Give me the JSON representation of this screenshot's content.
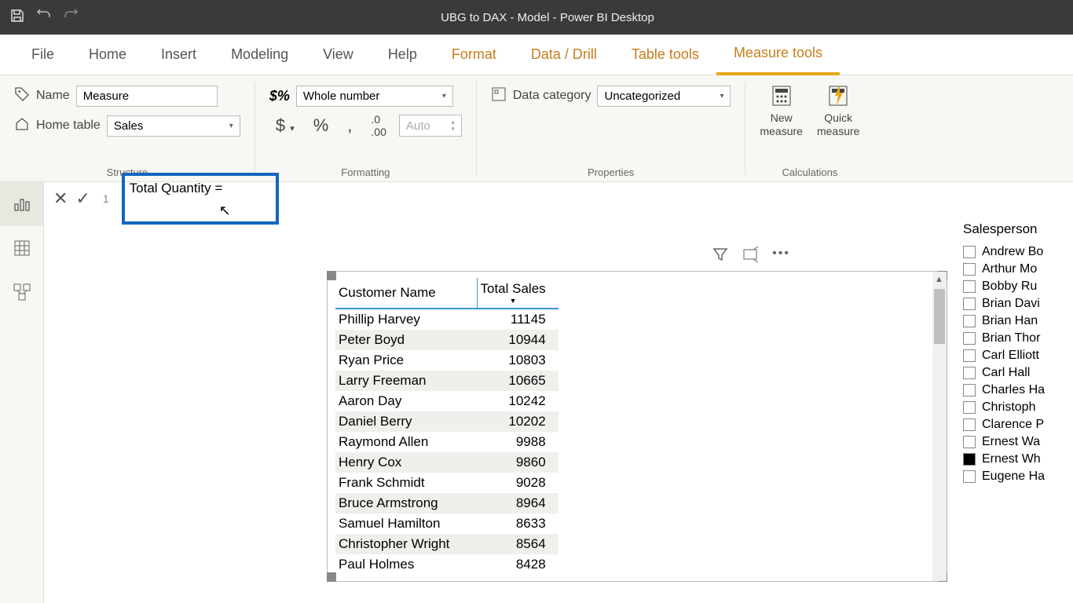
{
  "titlebar": {
    "title": "UBG to DAX - Model - Power BI Desktop"
  },
  "menubar": [
    "File",
    "Home",
    "Insert",
    "Modeling",
    "View",
    "Help",
    "Format",
    "Data / Drill",
    "Table tools",
    "Measure tools"
  ],
  "ribbon": {
    "name_label": "Name",
    "name_value": "Measure",
    "home_table_label": "Home table",
    "home_table_value": "Sales",
    "structure_label": "Structure",
    "format_value": "Whole number",
    "auto_placeholder": "Auto",
    "formatting_label": "Formatting",
    "data_category_label": "Data category",
    "data_category_value": "Uncategorized",
    "properties_label": "Properties",
    "new_measure": "New\nmeasure",
    "quick_measure": "Quick\nmeasure",
    "calculations_label": "Calculations"
  },
  "formula": {
    "line": "1",
    "text": "Total Quantity ="
  },
  "table": {
    "headers": [
      "Customer Name",
      "Total Sales"
    ],
    "rows": [
      {
        "name": "Phillip Harvey",
        "sales": "11145"
      },
      {
        "name": "Peter Boyd",
        "sales": "10944"
      },
      {
        "name": "Ryan Price",
        "sales": "10803"
      },
      {
        "name": "Larry Freeman",
        "sales": "10665"
      },
      {
        "name": "Aaron Day",
        "sales": "10242"
      },
      {
        "name": "Daniel Berry",
        "sales": "10202"
      },
      {
        "name": "Raymond Allen",
        "sales": "9988"
      },
      {
        "name": "Henry Cox",
        "sales": "9860"
      },
      {
        "name": "Frank Schmidt",
        "sales": "9028"
      },
      {
        "name": "Bruce Armstrong",
        "sales": "8964"
      },
      {
        "name": "Samuel Hamilton",
        "sales": "8633"
      },
      {
        "name": "Christopher Wright",
        "sales": "8564"
      },
      {
        "name": "Paul Holmes",
        "sales": "8428"
      }
    ]
  },
  "slicer": {
    "title": "Salesperson",
    "items": [
      {
        "label": "Andrew Bo",
        "checked": false
      },
      {
        "label": "Arthur Mo",
        "checked": false
      },
      {
        "label": "Bobby Ru",
        "checked": false
      },
      {
        "label": "Brian Davi",
        "checked": false
      },
      {
        "label": "Brian Han",
        "checked": false
      },
      {
        "label": "Brian Thor",
        "checked": false
      },
      {
        "label": "Carl Elliott",
        "checked": false
      },
      {
        "label": "Carl Hall",
        "checked": false
      },
      {
        "label": "Charles Ha",
        "checked": false
      },
      {
        "label": "Christoph",
        "checked": false
      },
      {
        "label": "Clarence P",
        "checked": false
      },
      {
        "label": "Ernest Wa",
        "checked": false
      },
      {
        "label": "Ernest Wh",
        "checked": true
      },
      {
        "label": "Eugene Ha",
        "checked": false
      }
    ]
  }
}
